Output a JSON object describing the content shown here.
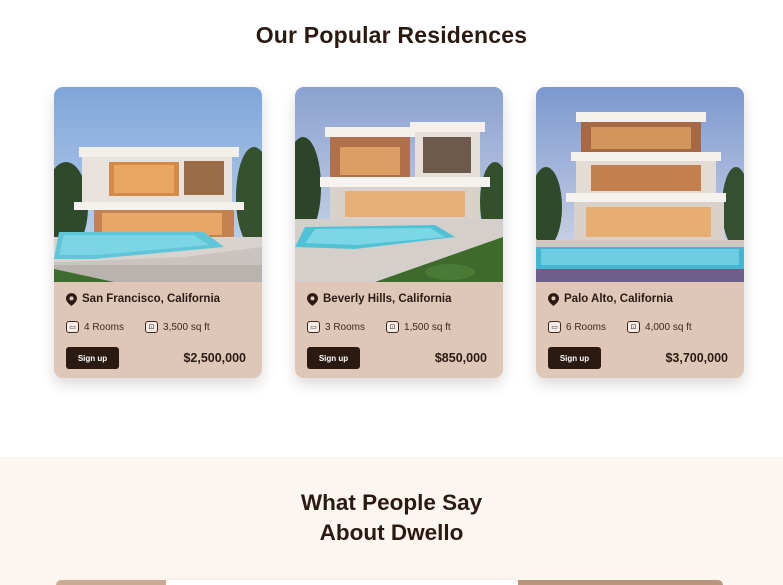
{
  "popular": {
    "title": "Our Popular Residences",
    "cards": [
      {
        "location": "San Francisco, California",
        "rooms": "4 Rooms",
        "area": "3,500 sq ft",
        "button": "Sign up",
        "price": "$2,500,000"
      },
      {
        "location": "Beverly Hills, California",
        "rooms": "3 Rooms",
        "area": "1,500 sq ft",
        "button": "Sign up",
        "price": "$850,000"
      },
      {
        "location": "Palo Alto, California",
        "rooms": "6 Rooms",
        "area": "4,000 sq ft",
        "button": "Sign up",
        "price": "$3,700,000"
      }
    ]
  },
  "testimonials": {
    "title_line1": "What People Say",
    "title_line2": "About Dwello"
  },
  "icons": {
    "location": "location-pin-icon",
    "rooms": "bed-icon",
    "area": "area-icon"
  },
  "colors": {
    "brand_dark": "#2a1a12",
    "card_bg": "#dfc7b7",
    "section_bg": "#fdf5f0"
  }
}
